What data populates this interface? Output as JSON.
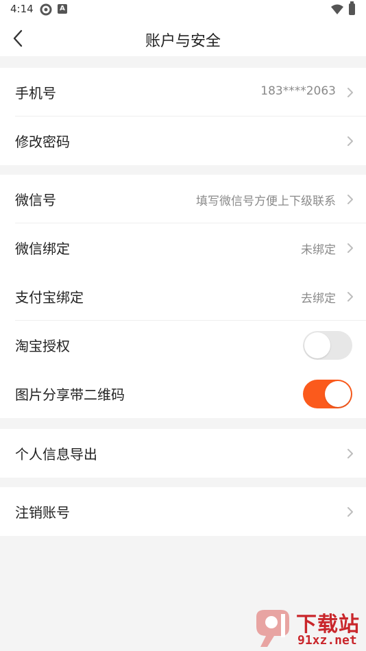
{
  "status_bar": {
    "time": "4:14",
    "badge_letter": "A"
  },
  "header": {
    "title": "账户与安全"
  },
  "groups": [
    {
      "rows": [
        {
          "label": "手机号",
          "value": "183****2063"
        },
        {
          "label": "修改密码",
          "value": ""
        }
      ]
    },
    {
      "rows": [
        {
          "label": "微信号",
          "value": "填写微信号方便上下级联系"
        },
        {
          "label": "微信绑定",
          "value": "未绑定"
        },
        {
          "label": "支付宝绑定",
          "value": "去绑定"
        },
        {
          "label": "淘宝授权",
          "toggle": false
        },
        {
          "label": "图片分享带二维码",
          "toggle": true
        }
      ]
    },
    {
      "rows": [
        {
          "label": "个人信息导出",
          "value": ""
        }
      ]
    },
    {
      "rows": [
        {
          "label": "注销账号",
          "value": ""
        }
      ]
    }
  ],
  "colors": {
    "accent": "#fb5a1c",
    "toggle_off": "#e7e7e7",
    "background": "#f4f4f4",
    "watermark": "#c9262b"
  },
  "icons": {
    "back": "chevron-left-icon",
    "row_arrow": "chevron-right-icon"
  },
  "watermark": {
    "text": "下载站",
    "url": "91xz.net"
  }
}
